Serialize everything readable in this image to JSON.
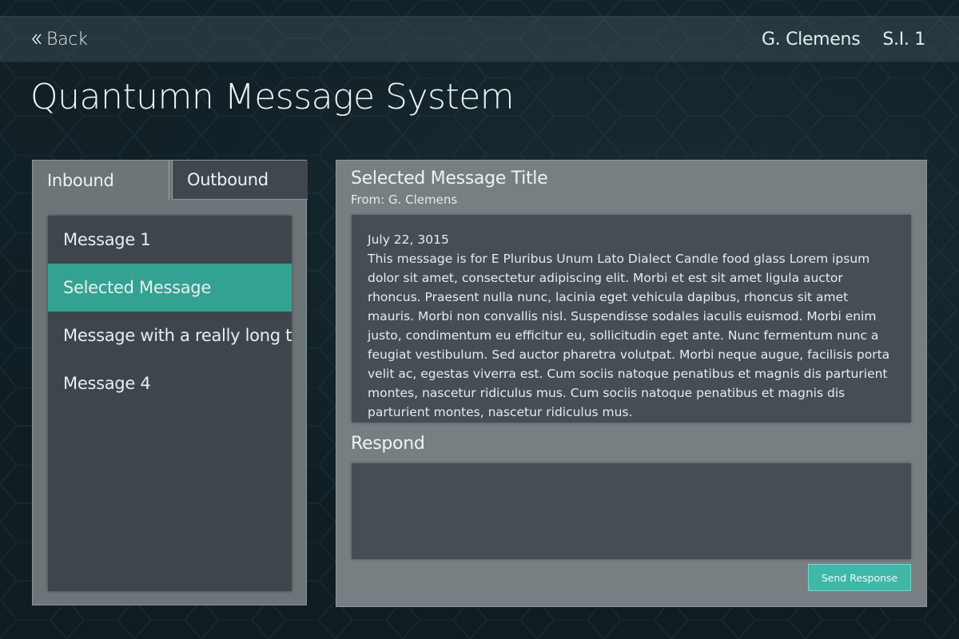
{
  "header": {
    "back_label": "Back",
    "user_name": "G. Clemens",
    "session": "S.I. 1"
  },
  "app_title": "Quantumn Message System",
  "tabs": [
    {
      "label": "Inbound",
      "active": true
    },
    {
      "label": "Outbound",
      "active": false
    }
  ],
  "messages": [
    {
      "label": "Message 1"
    },
    {
      "label": "Selected Message",
      "selected": true
    },
    {
      "label": "Message with a really long title that is truncated"
    },
    {
      "label": "Message 4"
    }
  ],
  "selected_message": {
    "title": "Selected Message Title",
    "from": "From: G. Clemens",
    "date": "July 22, 3015",
    "body": "This message is for E Pluribus Unum Lato Dialect Candle food glass Lorem ipsum dolor sit amet, consectetur adipiscing elit. Morbi et est sit amet ligula auctor rhoncus. Praesent nulla nunc, lacinia eget vehicula dapibus, rhoncus sit amet mauris. Morbi non convallis nisl. Suspendisse sodales iaculis euismod. Morbi enim justo, condimentum eu efficitur eu, sollicitudin eget ante. Nunc fermentum nunc a feugiat vestibulum. Sed auctor pharetra volutpat. Morbi neque augue, facilisis porta velit ac, egestas viverra est. Cum sociis natoque penatibus et magnis dis parturient montes, nascetur ridiculus mus. Cum sociis natoque penatibus et magnis dis parturient montes, nascetur ridiculus mus."
  },
  "respond": {
    "label": "Respond",
    "value": "",
    "send_label": "Send Response"
  },
  "colors": {
    "accent": "#34a292",
    "button": "#3fb7a9",
    "background": "#0f1c22"
  }
}
